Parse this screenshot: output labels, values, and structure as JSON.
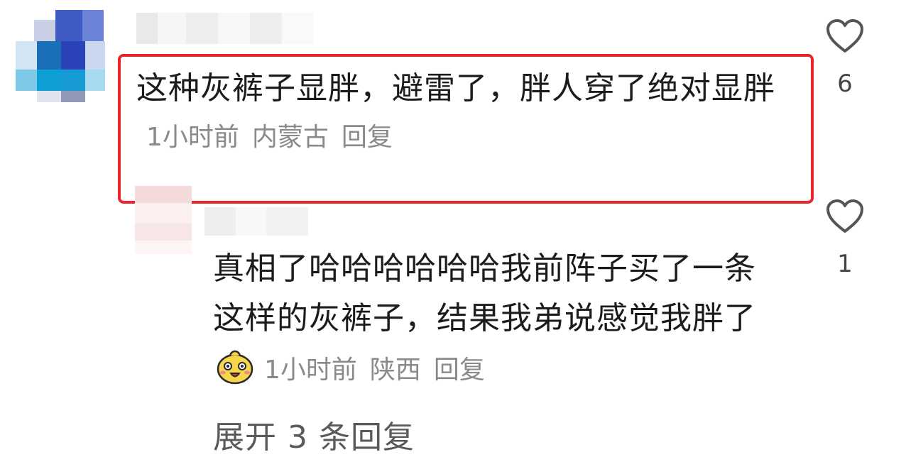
{
  "comments": [
    {
      "text": "这种灰裤子显胖，避雷了，胖人穿了绝对显胖",
      "time": "1小时前",
      "location": "内蒙古",
      "reply_label": "回复",
      "likes": "6",
      "highlighted": true
    },
    {
      "text": "真相了哈哈哈哈哈哈我前阵子买了一条这样的灰裤子，结果我弟说感觉我胖了",
      "time": "1小时前",
      "location": "陕西",
      "reply_label": "回复",
      "likes": "1",
      "emoji": "laughing-face-emoji"
    }
  ],
  "expand_replies": "展开 3 条回复",
  "colors": {
    "highlight": "#e8262b",
    "meta": "#8a8a8a",
    "heart": "#555555"
  },
  "icons": {
    "like": "heart-outline-icon"
  }
}
